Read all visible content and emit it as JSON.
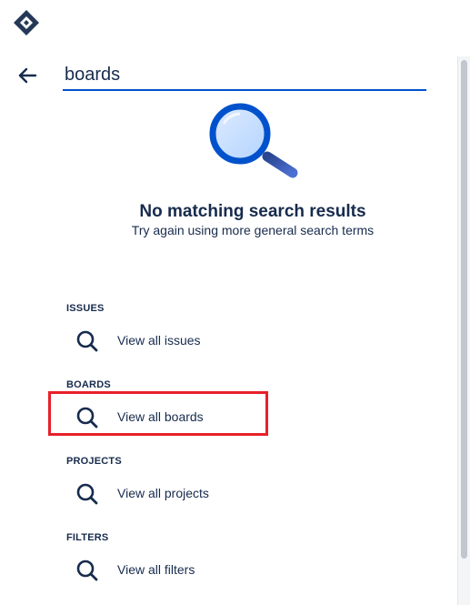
{
  "search": {
    "value": "boards",
    "placeholder": ""
  },
  "empty_state": {
    "title": "No matching search results",
    "subtitle": "Try again using more general search terms"
  },
  "sections": [
    {
      "heading": "ISSUES",
      "link": "View all issues"
    },
    {
      "heading": "BOARDS",
      "link": "View all boards"
    },
    {
      "heading": "PROJECTS",
      "link": "View all projects"
    },
    {
      "heading": "FILTERS",
      "link": "View all filters"
    }
  ],
  "colors": {
    "accent": "#0052CC",
    "text": "#172B4D",
    "highlight": "#E8202A"
  },
  "icons": {
    "logo": "jira-logo-icon",
    "back": "arrow-left-icon",
    "result": "search-icon"
  }
}
